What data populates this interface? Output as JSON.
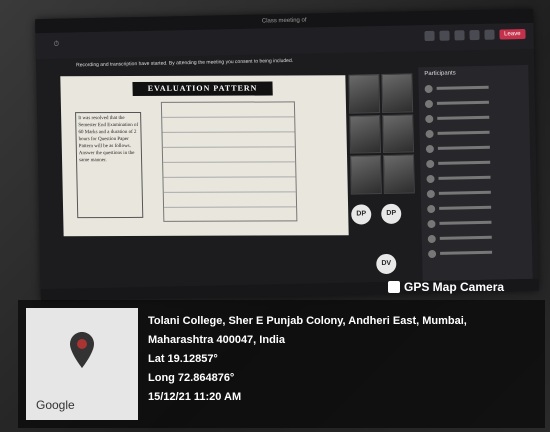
{
  "teams": {
    "window_title": "Class meeting of",
    "leave_label": "Leave",
    "notice": "Recording and transcription have started. By attending the meeting you consent to being included.",
    "participants_header": "Participants"
  },
  "slide": {
    "title": "EVALUATION PATTERN",
    "text": "It was resolved that the Semester End Examination of 60 Marks and a duration of 2 hours for Question Paper Pattern will be as follows. Answer the questions in the same manner."
  },
  "avatars": [
    "DP",
    "DP",
    "DV"
  ],
  "gps": {
    "camera_label": "GPS Map Camera",
    "address": "Tolani College, Sher E Punjab Colony, Andheri East, Mumbai, Maharashtra 400047, India",
    "lat": "Lat 19.12857°",
    "long": "Long 72.864876°",
    "datetime": "15/12/21 11:20 AM",
    "map_logo": "Google"
  }
}
